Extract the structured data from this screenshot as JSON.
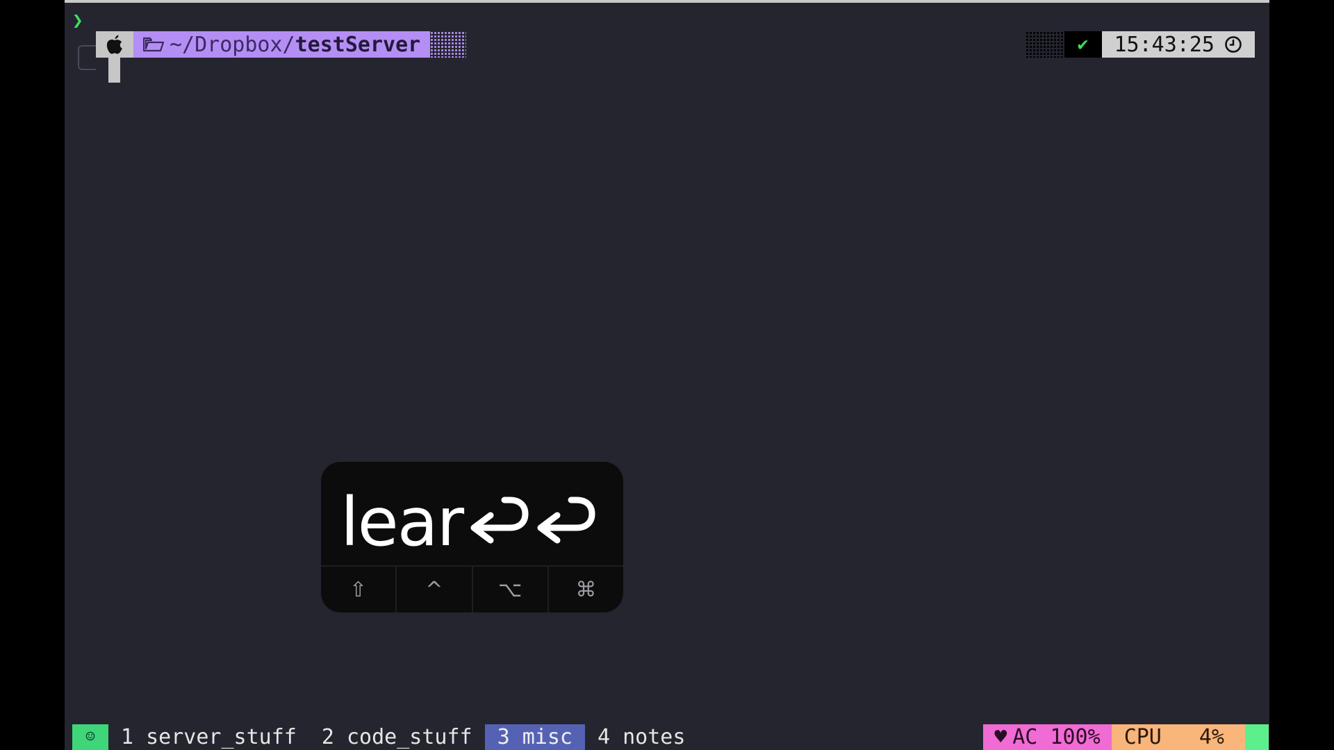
{
  "prompt": {
    "chevron": "❯",
    "os_icon": "apple-icon",
    "folder_icon": "folder-open-icon",
    "dir_prefix": "~/Dropbox/",
    "dir_leaf": "testServer"
  },
  "right_prompt": {
    "status": "✔",
    "time": "15:43:25",
    "clock_icon": "clock-icon"
  },
  "keycast": {
    "typed": "lear",
    "return_icon": "return-icon",
    "modifiers": [
      "⇧",
      "^",
      "⌥",
      "⌘"
    ]
  },
  "tmux": {
    "session_icon": "☺",
    "windows": [
      {
        "label": "1 server_stuff",
        "active": false
      },
      {
        "label": "2 code_stuff",
        "active": false
      },
      {
        "label": "3 misc",
        "active": true
      },
      {
        "label": "4 notes",
        "active": false
      }
    ],
    "power": {
      "icon": "♥",
      "text": "AC 100%"
    },
    "cpu": {
      "label": "CPU",
      "value": "4%"
    }
  },
  "colors": {
    "terminal_bg": "#24252f",
    "dir_segment": "#b48ef5",
    "accent_green": "#3ee05a",
    "active_window": "#5562b4",
    "power_segment": "#f06bd4",
    "cpu_segment": "#f9b57a"
  }
}
